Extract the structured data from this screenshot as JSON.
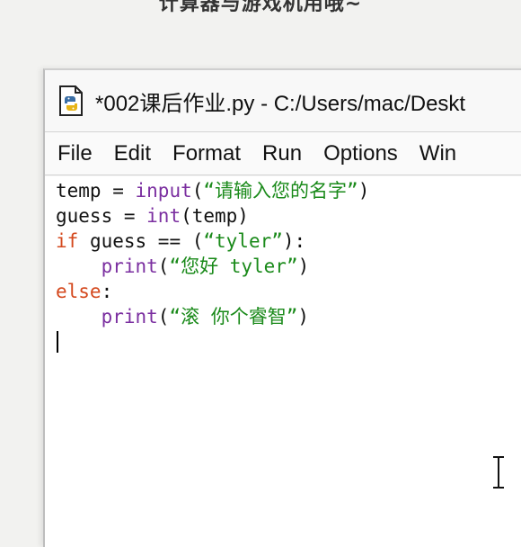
{
  "caption": "计算器与游戏机用哦~",
  "window": {
    "title": "*002课后作业.py - C:/Users/mac/Deskt",
    "app_icon": "python-idle-icon"
  },
  "menu": [
    "File",
    "Edit",
    "Format",
    "Run",
    "Options",
    "Win"
  ],
  "code_lines": [
    [
      {
        "t": "temp = "
      },
      {
        "t": "input",
        "c": "bi"
      },
      {
        "t": "("
      },
      {
        "t": "“请输入您的名字”",
        "c": "str"
      },
      {
        "t": ")"
      }
    ],
    [
      {
        "t": "guess = "
      },
      {
        "t": "int",
        "c": "bi"
      },
      {
        "t": "(temp)"
      }
    ],
    [
      {
        "t": "if",
        "c": "kw"
      },
      {
        "t": " guess == ("
      },
      {
        "t": "“tyler”",
        "c": "str"
      },
      {
        "t": "):"
      }
    ],
    [
      {
        "t": "    "
      },
      {
        "t": "print",
        "c": "bi"
      },
      {
        "t": "("
      },
      {
        "t": "“您好 tyler”",
        "c": "str"
      },
      {
        "t": ")"
      }
    ],
    [
      {
        "t": "else",
        "c": "kw"
      },
      {
        "t": ":"
      }
    ],
    [
      {
        "t": "    "
      },
      {
        "t": "print",
        "c": "bi"
      },
      {
        "t": "("
      },
      {
        "t": "“滚 你个睿智”",
        "c": "str"
      },
      {
        "t": ")"
      }
    ]
  ],
  "colors": {
    "keyword": "#d4481d",
    "builtin": "#7b2fa0",
    "string": "#1a8a1a"
  },
  "cursor_icon": "text-ibeam-cursor-icon"
}
